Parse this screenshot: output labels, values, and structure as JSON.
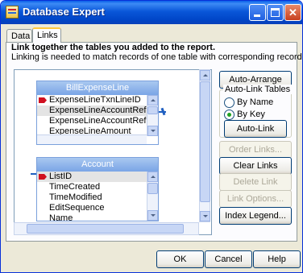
{
  "window": {
    "title": "Database Expert"
  },
  "tabs": [
    {
      "label": "Data"
    },
    {
      "label": "Links"
    }
  ],
  "header": {
    "heading": "Link together the tables you added to the report.",
    "subtext": "Linking is needed to match records of one table with corresponding records of another table."
  },
  "tables": {
    "first": {
      "name": "BillExpenseLine",
      "fields": [
        "ExpenseLineTxnLineID",
        "ExpenseLineAccountRefListID",
        "ExpenseLineAccountRefFullName",
        "ExpenseLineAmount"
      ]
    },
    "second": {
      "name": "Account",
      "fields": [
        "ListID",
        "TimeCreated",
        "TimeModified",
        "EditSequence",
        "Name"
      ]
    }
  },
  "buttons": {
    "auto_arrange": "Auto-Arrange",
    "auto_link": "Auto-Link",
    "order_links": "Order Links...",
    "clear_links": "Clear Links",
    "delete_link": "Delete Link",
    "link_options": "Link Options...",
    "index_legend": "Index Legend...",
    "ok": "OK",
    "cancel": "Cancel",
    "help": "Help"
  },
  "auto_link_group": {
    "label": "Auto-Link Tables",
    "options": [
      {
        "label": "By Name",
        "checked": false
      },
      {
        "label": "By Key",
        "checked": true
      }
    ]
  },
  "colors": {
    "title_bar": "#0a57d9",
    "table_header": "#7aa5e6",
    "link_line": "#1f5fc0",
    "key_marker": "#d01020"
  }
}
